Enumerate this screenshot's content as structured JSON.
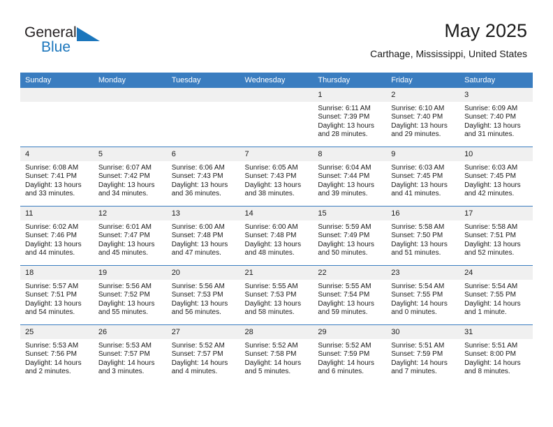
{
  "brand": {
    "name_part1": "General",
    "name_part2": "Blue",
    "triangle_color": "#1b76bc"
  },
  "header": {
    "title": "May 2025",
    "subtitle": "Carthage, Mississippi, United States",
    "header_bg_color": "#3a7dc0",
    "daynum_bg_color": "#f0f0f0"
  },
  "weekdays": [
    "Sunday",
    "Monday",
    "Tuesday",
    "Wednesday",
    "Thursday",
    "Friday",
    "Saturday"
  ],
  "weeks": [
    [
      {
        "day": "",
        "sunrise": "",
        "sunset": "",
        "daylight1": "",
        "daylight2": ""
      },
      {
        "day": "",
        "sunrise": "",
        "sunset": "",
        "daylight1": "",
        "daylight2": ""
      },
      {
        "day": "",
        "sunrise": "",
        "sunset": "",
        "daylight1": "",
        "daylight2": ""
      },
      {
        "day": "",
        "sunrise": "",
        "sunset": "",
        "daylight1": "",
        "daylight2": ""
      },
      {
        "day": "1",
        "sunrise": "Sunrise: 6:11 AM",
        "sunset": "Sunset: 7:39 PM",
        "daylight1": "Daylight: 13 hours",
        "daylight2": "and 28 minutes."
      },
      {
        "day": "2",
        "sunrise": "Sunrise: 6:10 AM",
        "sunset": "Sunset: 7:40 PM",
        "daylight1": "Daylight: 13 hours",
        "daylight2": "and 29 minutes."
      },
      {
        "day": "3",
        "sunrise": "Sunrise: 6:09 AM",
        "sunset": "Sunset: 7:40 PM",
        "daylight1": "Daylight: 13 hours",
        "daylight2": "and 31 minutes."
      }
    ],
    [
      {
        "day": "4",
        "sunrise": "Sunrise: 6:08 AM",
        "sunset": "Sunset: 7:41 PM",
        "daylight1": "Daylight: 13 hours",
        "daylight2": "and 33 minutes."
      },
      {
        "day": "5",
        "sunrise": "Sunrise: 6:07 AM",
        "sunset": "Sunset: 7:42 PM",
        "daylight1": "Daylight: 13 hours",
        "daylight2": "and 34 minutes."
      },
      {
        "day": "6",
        "sunrise": "Sunrise: 6:06 AM",
        "sunset": "Sunset: 7:43 PM",
        "daylight1": "Daylight: 13 hours",
        "daylight2": "and 36 minutes."
      },
      {
        "day": "7",
        "sunrise": "Sunrise: 6:05 AM",
        "sunset": "Sunset: 7:43 PM",
        "daylight1": "Daylight: 13 hours",
        "daylight2": "and 38 minutes."
      },
      {
        "day": "8",
        "sunrise": "Sunrise: 6:04 AM",
        "sunset": "Sunset: 7:44 PM",
        "daylight1": "Daylight: 13 hours",
        "daylight2": "and 39 minutes."
      },
      {
        "day": "9",
        "sunrise": "Sunrise: 6:03 AM",
        "sunset": "Sunset: 7:45 PM",
        "daylight1": "Daylight: 13 hours",
        "daylight2": "and 41 minutes."
      },
      {
        "day": "10",
        "sunrise": "Sunrise: 6:03 AM",
        "sunset": "Sunset: 7:45 PM",
        "daylight1": "Daylight: 13 hours",
        "daylight2": "and 42 minutes."
      }
    ],
    [
      {
        "day": "11",
        "sunrise": "Sunrise: 6:02 AM",
        "sunset": "Sunset: 7:46 PM",
        "daylight1": "Daylight: 13 hours",
        "daylight2": "and 44 minutes."
      },
      {
        "day": "12",
        "sunrise": "Sunrise: 6:01 AM",
        "sunset": "Sunset: 7:47 PM",
        "daylight1": "Daylight: 13 hours",
        "daylight2": "and 45 minutes."
      },
      {
        "day": "13",
        "sunrise": "Sunrise: 6:00 AM",
        "sunset": "Sunset: 7:48 PM",
        "daylight1": "Daylight: 13 hours",
        "daylight2": "and 47 minutes."
      },
      {
        "day": "14",
        "sunrise": "Sunrise: 6:00 AM",
        "sunset": "Sunset: 7:48 PM",
        "daylight1": "Daylight: 13 hours",
        "daylight2": "and 48 minutes."
      },
      {
        "day": "15",
        "sunrise": "Sunrise: 5:59 AM",
        "sunset": "Sunset: 7:49 PM",
        "daylight1": "Daylight: 13 hours",
        "daylight2": "and 50 minutes."
      },
      {
        "day": "16",
        "sunrise": "Sunrise: 5:58 AM",
        "sunset": "Sunset: 7:50 PM",
        "daylight1": "Daylight: 13 hours",
        "daylight2": "and 51 minutes."
      },
      {
        "day": "17",
        "sunrise": "Sunrise: 5:58 AM",
        "sunset": "Sunset: 7:51 PM",
        "daylight1": "Daylight: 13 hours",
        "daylight2": "and 52 minutes."
      }
    ],
    [
      {
        "day": "18",
        "sunrise": "Sunrise: 5:57 AM",
        "sunset": "Sunset: 7:51 PM",
        "daylight1": "Daylight: 13 hours",
        "daylight2": "and 54 minutes."
      },
      {
        "day": "19",
        "sunrise": "Sunrise: 5:56 AM",
        "sunset": "Sunset: 7:52 PM",
        "daylight1": "Daylight: 13 hours",
        "daylight2": "and 55 minutes."
      },
      {
        "day": "20",
        "sunrise": "Sunrise: 5:56 AM",
        "sunset": "Sunset: 7:53 PM",
        "daylight1": "Daylight: 13 hours",
        "daylight2": "and 56 minutes."
      },
      {
        "day": "21",
        "sunrise": "Sunrise: 5:55 AM",
        "sunset": "Sunset: 7:53 PM",
        "daylight1": "Daylight: 13 hours",
        "daylight2": "and 58 minutes."
      },
      {
        "day": "22",
        "sunrise": "Sunrise: 5:55 AM",
        "sunset": "Sunset: 7:54 PM",
        "daylight1": "Daylight: 13 hours",
        "daylight2": "and 59 minutes."
      },
      {
        "day": "23",
        "sunrise": "Sunrise: 5:54 AM",
        "sunset": "Sunset: 7:55 PM",
        "daylight1": "Daylight: 14 hours",
        "daylight2": "and 0 minutes."
      },
      {
        "day": "24",
        "sunrise": "Sunrise: 5:54 AM",
        "sunset": "Sunset: 7:55 PM",
        "daylight1": "Daylight: 14 hours",
        "daylight2": "and 1 minute."
      }
    ],
    [
      {
        "day": "25",
        "sunrise": "Sunrise: 5:53 AM",
        "sunset": "Sunset: 7:56 PM",
        "daylight1": "Daylight: 14 hours",
        "daylight2": "and 2 minutes."
      },
      {
        "day": "26",
        "sunrise": "Sunrise: 5:53 AM",
        "sunset": "Sunset: 7:57 PM",
        "daylight1": "Daylight: 14 hours",
        "daylight2": "and 3 minutes."
      },
      {
        "day": "27",
        "sunrise": "Sunrise: 5:52 AM",
        "sunset": "Sunset: 7:57 PM",
        "daylight1": "Daylight: 14 hours",
        "daylight2": "and 4 minutes."
      },
      {
        "day": "28",
        "sunrise": "Sunrise: 5:52 AM",
        "sunset": "Sunset: 7:58 PM",
        "daylight1": "Daylight: 14 hours",
        "daylight2": "and 5 minutes."
      },
      {
        "day": "29",
        "sunrise": "Sunrise: 5:52 AM",
        "sunset": "Sunset: 7:59 PM",
        "daylight1": "Daylight: 14 hours",
        "daylight2": "and 6 minutes."
      },
      {
        "day": "30",
        "sunrise": "Sunrise: 5:51 AM",
        "sunset": "Sunset: 7:59 PM",
        "daylight1": "Daylight: 14 hours",
        "daylight2": "and 7 minutes."
      },
      {
        "day": "31",
        "sunrise": "Sunrise: 5:51 AM",
        "sunset": "Sunset: 8:00 PM",
        "daylight1": "Daylight: 14 hours",
        "daylight2": "and 8 minutes."
      }
    ]
  ]
}
